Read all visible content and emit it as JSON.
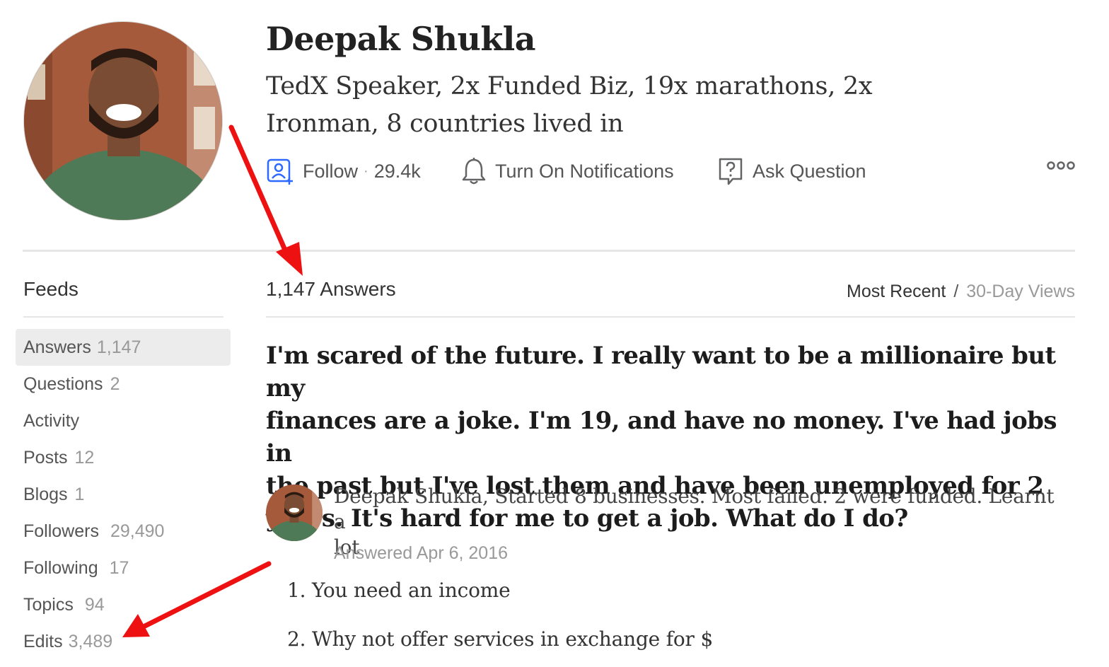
{
  "profile": {
    "name": "Deepak Shukla",
    "tagline_line1": "TedX Speaker, 2x Funded Biz, 19x marathons, 2x",
    "tagline_line2": "Ironman, 8 countries lived in"
  },
  "actions": {
    "follow_label": "Follow",
    "follow_count": "29.4k",
    "notifications_label": "Turn On Notifications",
    "ask_label": "Ask Question",
    "accent_color": "#2e69ff"
  },
  "sidebar": {
    "title": "Feeds",
    "items": [
      {
        "label": "Answers",
        "count": "1,147",
        "active": true
      },
      {
        "label": "Questions",
        "count": "2"
      },
      {
        "label": "Activity",
        "count": ""
      },
      {
        "label": "Posts",
        "count": "12"
      },
      {
        "label": "Blogs",
        "count": "1"
      },
      {
        "label": "Followers",
        "count": "29,490"
      },
      {
        "label": "Following",
        "count": "17"
      },
      {
        "label": "Topics",
        "count": "94"
      },
      {
        "label": "Edits",
        "count": "3,489"
      }
    ]
  },
  "main": {
    "answers_heading": "1,147 Answers",
    "sort_active": "Most Recent",
    "sort_separator": "/",
    "sort_inactive": "30-Day Views",
    "question_lines": [
      "I'm scared of the future. I really want to be a millionaire but my",
      "finances are a joke. I'm 19, and have no money. I've had jobs in",
      "the past but I've lost them and have been unemployed for 2",
      "years. It's hard for me to get a job. What do I do?"
    ],
    "credential_line1": "Deepak Shukla, Started 8 businesses. Most failed. 2 were funded. Learnt a",
    "credential_line2": "lot",
    "answered_date": "Answered Apr 6, 2016",
    "answer_lines": [
      "1. You need an income",
      "2. Why not offer services in exchange for $"
    ]
  },
  "annotations": {
    "arrow_color": "#ee1111"
  }
}
